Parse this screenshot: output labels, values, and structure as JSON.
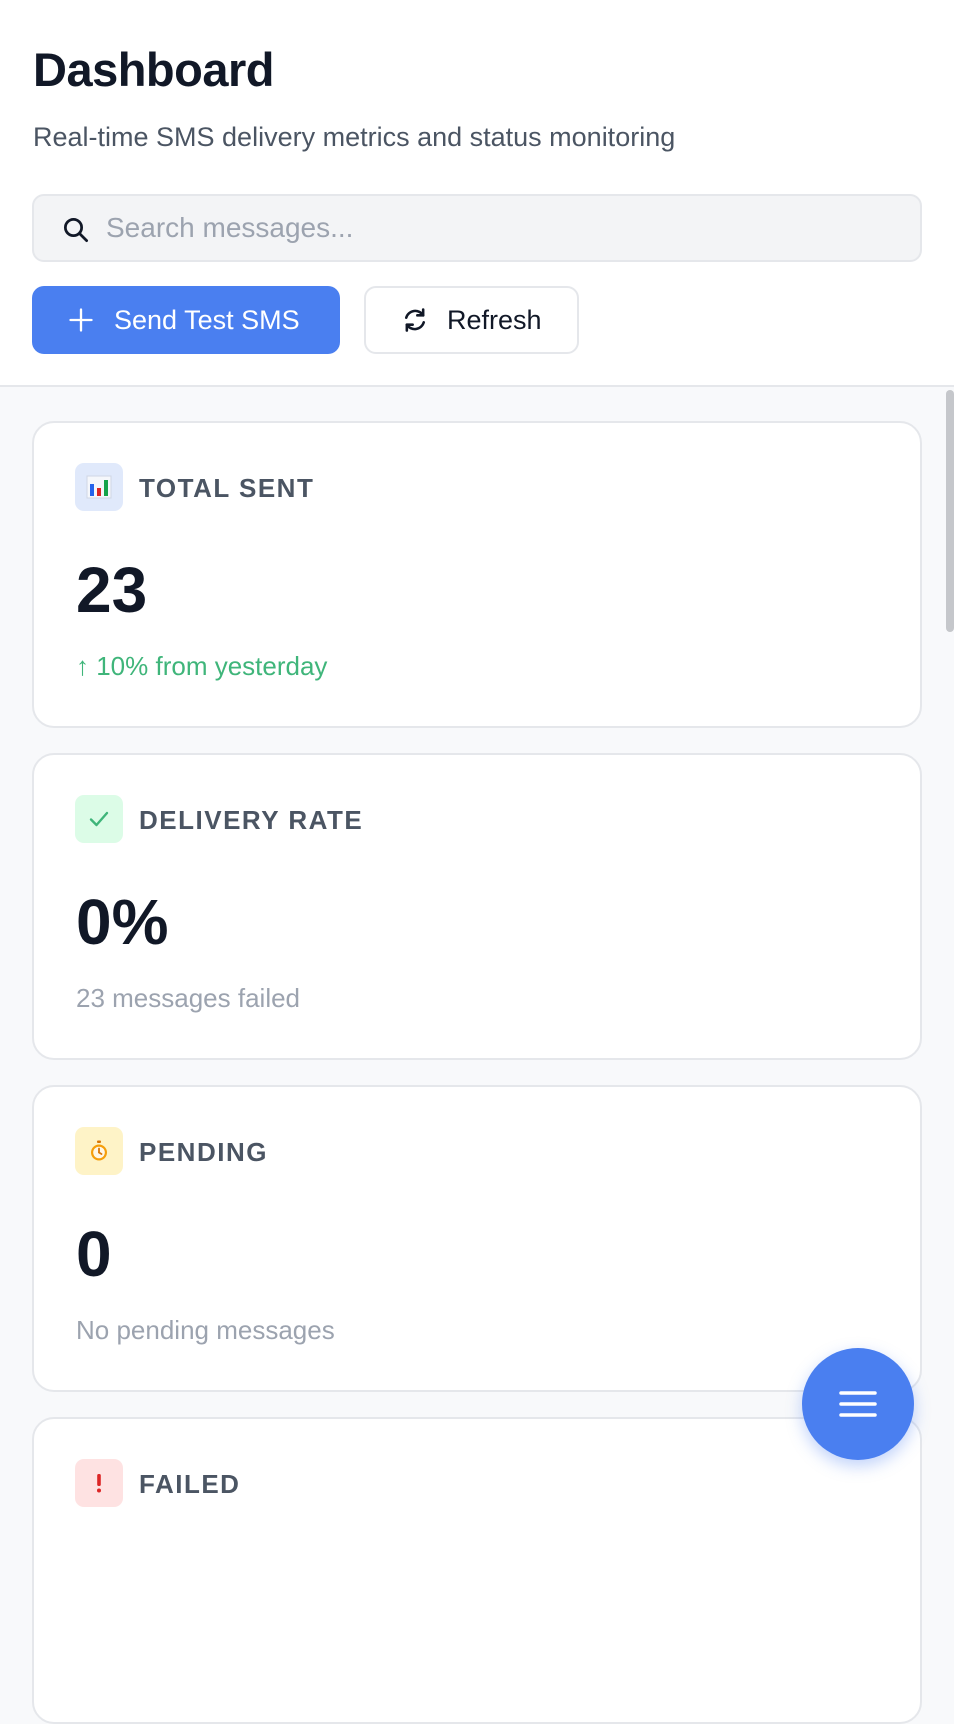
{
  "header": {
    "title": "Dashboard",
    "subtitle": "Real-time SMS delivery metrics and status monitoring"
  },
  "search": {
    "placeholder": "Search messages...",
    "value": ""
  },
  "actions": {
    "send_test_label": "Send Test SMS",
    "refresh_label": "Refresh"
  },
  "cards": [
    {
      "label": "TOTAL SENT",
      "value": "23",
      "note": "↑ 10% from yesterday",
      "icon": "bar-chart-icon",
      "badge_color": "#e0e9fb",
      "note_color": "#3fb57a"
    },
    {
      "label": "DELIVERY RATE",
      "value": "0%",
      "note": "23 messages failed",
      "icon": "check-icon",
      "badge_color": "#dcfce7",
      "note_color": "#9ca3af"
    },
    {
      "label": "PENDING",
      "value": "0",
      "note": "No pending messages",
      "icon": "stopwatch-icon",
      "badge_color": "#fef3c7",
      "note_color": "#9ca3af"
    },
    {
      "label": "FAILED",
      "value": "",
      "note": "",
      "icon": "exclamation-icon",
      "badge_color": "#fee2e2",
      "note_color": "#9ca3af"
    }
  ],
  "colors": {
    "primary": "#4a7ff0",
    "success": "#3fb57a",
    "danger": "#dc2626",
    "warning": "#f59e0b"
  },
  "fab": {
    "icon": "menu-icon"
  }
}
